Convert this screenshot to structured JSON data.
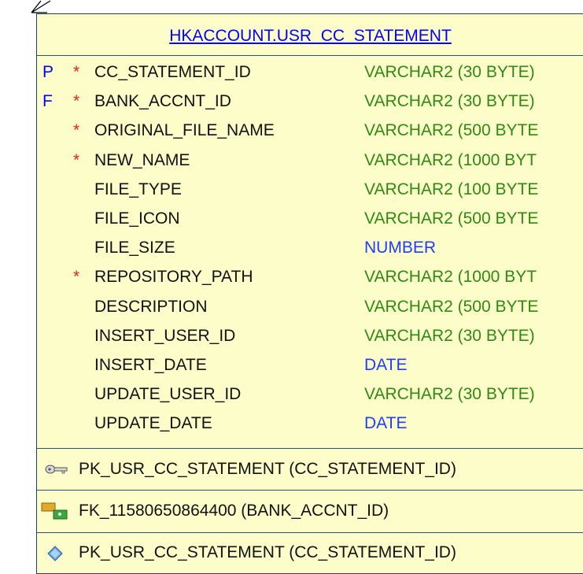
{
  "table": {
    "title": "HKACCOUNT.USR_CC_STATEMENT",
    "columns": [
      {
        "key": "P",
        "required": "*",
        "name": "CC_STATEMENT_ID",
        "type": "VARCHAR2 (30 BYTE)"
      },
      {
        "key": "F",
        "required": "*",
        "name": "BANK_ACCNT_ID",
        "type": "VARCHAR2 (30 BYTE)"
      },
      {
        "key": "",
        "required": "*",
        "name": "ORIGINAL_FILE_NAME",
        "type": "VARCHAR2 (500 BYTE"
      },
      {
        "key": "",
        "required": "*",
        "name": "NEW_NAME",
        "type": "VARCHAR2 (1000 BYT"
      },
      {
        "key": "",
        "required": "",
        "name": "FILE_TYPE",
        "type": "VARCHAR2 (100 BYTE"
      },
      {
        "key": "",
        "required": "",
        "name": "FILE_ICON",
        "type": "VARCHAR2 (500 BYTE"
      },
      {
        "key": "",
        "required": "",
        "name": "FILE_SIZE",
        "type": "NUMBER"
      },
      {
        "key": "",
        "required": "*",
        "name": "REPOSITORY_PATH",
        "type": "VARCHAR2 (1000 BYT"
      },
      {
        "key": "",
        "required": "",
        "name": "DESCRIPTION",
        "type": "VARCHAR2 (500 BYTE"
      },
      {
        "key": "",
        "required": "",
        "name": "INSERT_USER_ID",
        "type": "VARCHAR2 (30 BYTE)"
      },
      {
        "key": "",
        "required": "",
        "name": "INSERT_DATE",
        "type": "DATE"
      },
      {
        "key": "",
        "required": "",
        "name": "UPDATE_USER_ID",
        "type": "VARCHAR2 (30 BYTE)"
      },
      {
        "key": "",
        "required": "",
        "name": "UPDATE_DATE",
        "type": "DATE"
      }
    ],
    "constraints": {
      "primary_key": {
        "icon": "key-icon",
        "label": "PK_USR_CC_STATEMENT (CC_STATEMENT_ID)"
      },
      "foreign_key": {
        "icon": "foreign-key-icon",
        "label": "FK_11580650864400 (BANK_ACCNT_ID)"
      },
      "index": {
        "icon": "index-diamond-icon",
        "label": "PK_USR_CC_STATEMENT (CC_STATEMENT_ID)"
      }
    }
  },
  "colors": {
    "background": "#fdfdc9",
    "border": "#1f3f6f",
    "title": "#0000ff",
    "key_marker": "#0000ff",
    "required_marker": "#e0201c",
    "varchar_type": "#2f8a11",
    "number_date_type": "#1e3dff"
  }
}
